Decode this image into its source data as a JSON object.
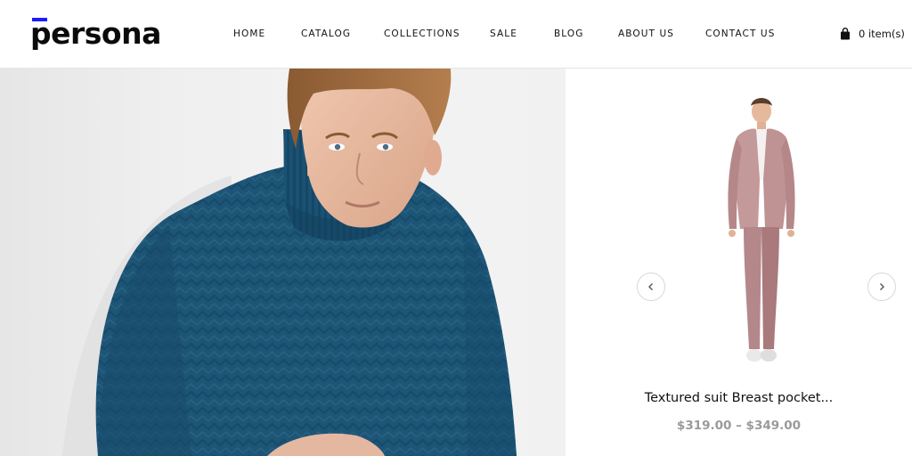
{
  "brand": {
    "name": "persona",
    "accent_color": "#1b1bff"
  },
  "nav": {
    "items": [
      {
        "label": "HOME"
      },
      {
        "label": "CATALOG"
      },
      {
        "label": "COLLECTIONS"
      },
      {
        "label": "SALE"
      },
      {
        "label": "BLOG"
      },
      {
        "label": "ABOUT US"
      },
      {
        "label": "CONTACT US"
      }
    ]
  },
  "cart": {
    "label": "0 item(s)",
    "icon": "shopping-bag-icon"
  },
  "hero": {
    "image": "man-in-blue-turtleneck-sweater-photo"
  },
  "product": {
    "image": "man-in-pink-suit-photo",
    "title": "Textured suit Breast pocket...",
    "price": "$319.00 – $349.00",
    "prev_icon": "chevron-left-icon",
    "next_icon": "chevron-right-icon"
  }
}
